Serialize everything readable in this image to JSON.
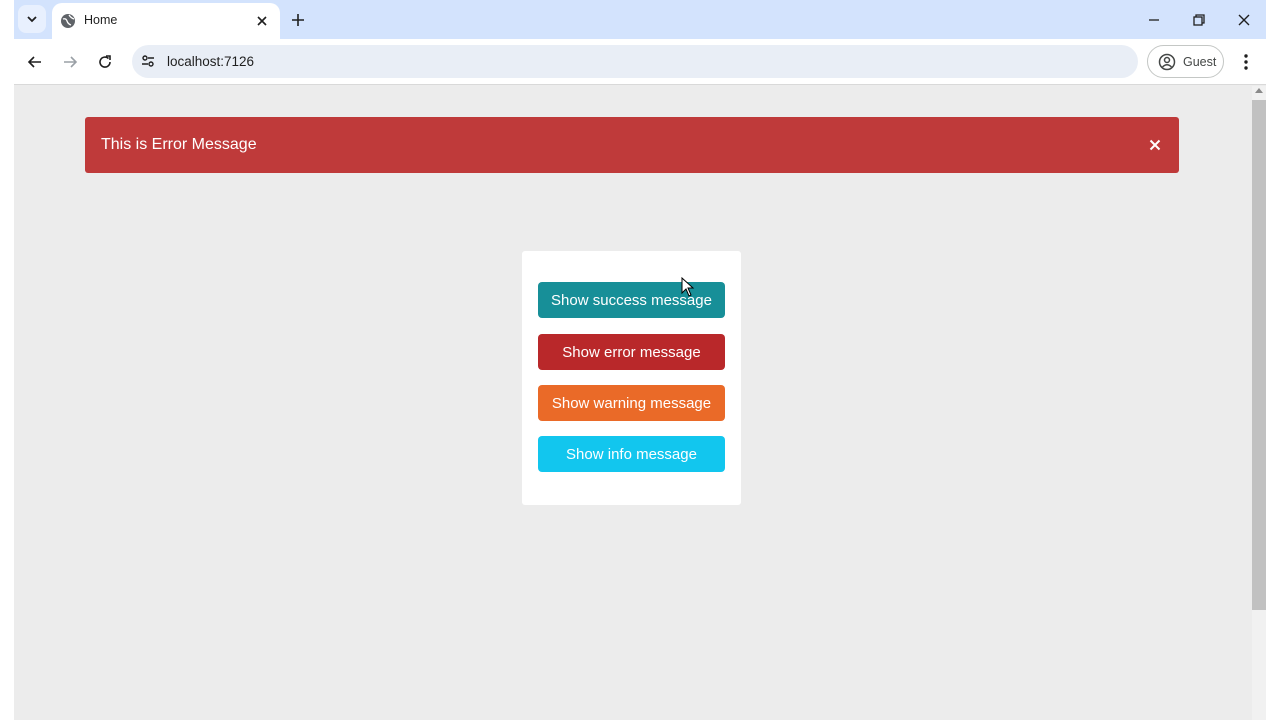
{
  "browser": {
    "tab_title": "Home",
    "url": "localhost:7126",
    "profile_label": "Guest",
    "colors": {
      "titlebar": "#d3e3fd",
      "omnibox": "#e9eef6"
    }
  },
  "alert": {
    "text": "This is Error Message",
    "color": "#bf3a3a",
    "close_icon": "close-icon"
  },
  "buttons": [
    {
      "label": "Show success message",
      "color": "#178f98"
    },
    {
      "label": "Show error message",
      "color": "#b9282a"
    },
    {
      "label": "Show warning message",
      "color": "#ea6a28"
    },
    {
      "label": "Show info message",
      "color": "#12c6ee"
    }
  ],
  "page": {
    "background": "#ececec"
  }
}
